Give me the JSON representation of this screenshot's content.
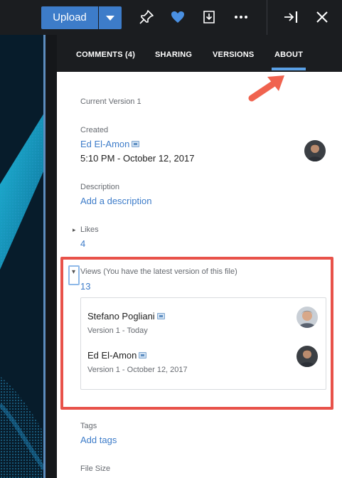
{
  "toolbar": {
    "upload_label": "Upload",
    "icons": [
      "pin-icon",
      "heart-icon",
      "download-icon",
      "more-icon",
      "collapse-panel-icon",
      "close-icon"
    ],
    "accent": "#3d7cc9"
  },
  "tabs": [
    {
      "label": "COMMENTS (4)"
    },
    {
      "label": "SHARING"
    },
    {
      "label": "VERSIONS"
    },
    {
      "label": "ABOUT",
      "active": true
    }
  ],
  "about": {
    "current_version": "Current Version 1",
    "created_label": "Created",
    "created_by": "Ed El-Amon",
    "created_at": "5:10 PM - October 12, 2017",
    "description_label": "Description",
    "add_description": "Add a description",
    "likes_label": "Likes",
    "likes_count": "4",
    "views_label": "Views (You have the latest version of this file)",
    "views_count": "13",
    "viewers": [
      {
        "name": "Stefano Pogliani",
        "detail": "Version 1 - Today"
      },
      {
        "name": "Ed El-Amon",
        "detail": "Version 1 - October 12, 2017"
      }
    ],
    "tags_label": "Tags",
    "add_tags": "Add tags",
    "file_size_label": "File Size"
  },
  "annotation_color": "#e8524a"
}
